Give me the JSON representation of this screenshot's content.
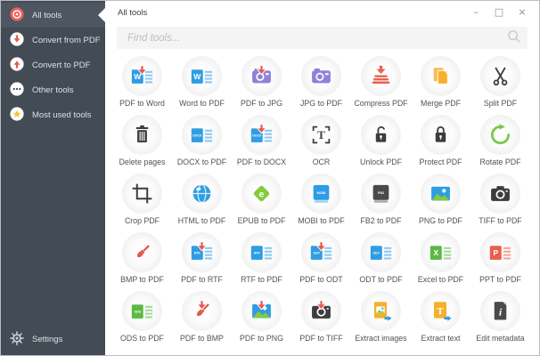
{
  "palette": {
    "sidebar_bg": "#434b55",
    "sidebar_selected_bg": "#4d5661",
    "accent_red": "#e8574d",
    "accent_blue": "#2f9de4",
    "accent_yellow": "#f5b02e",
    "accent_purple": "#8d82d8",
    "accent_green": "#5cb943",
    "accent_lime": "#84cc3a",
    "icon_dark": "#3d3d3d"
  },
  "window": {
    "controls": [
      {
        "name": "minimize",
        "glyph": "–"
      },
      {
        "name": "maximize",
        "glyph": "□"
      },
      {
        "name": "close",
        "glyph": "×"
      }
    ]
  },
  "sidebar": {
    "items": [
      {
        "label": "All tools",
        "icon": "target",
        "selected": true
      },
      {
        "label": "Convert from PDF",
        "icon": "arrow-down-circle",
        "selected": false
      },
      {
        "label": "Convert to PDF",
        "icon": "arrow-up-circle",
        "selected": false
      },
      {
        "label": "Other tools",
        "icon": "ellipsis-circle",
        "selected": false
      },
      {
        "label": "Most used tools",
        "icon": "star-circle",
        "selected": false
      }
    ],
    "settings": {
      "label": "Settings",
      "icon": "gear"
    }
  },
  "header": {
    "title": "All tools"
  },
  "search": {
    "placeholder": "Find tools..."
  },
  "tools": [
    {
      "label": "PDF to Word",
      "icon": {
        "type": "doc",
        "letters": "W",
        "color": "#2f9de4",
        "arrow": true
      }
    },
    {
      "label": "Word to PDF",
      "icon": {
        "type": "doc",
        "letters": "W",
        "color": "#2f9de4",
        "arrow": false
      }
    },
    {
      "label": "PDF to JPG",
      "icon": {
        "type": "photo",
        "color": "#8d82d8",
        "arrow": true
      }
    },
    {
      "label": "JPG to PDF",
      "icon": {
        "type": "photo",
        "color": "#8d82d8",
        "arrow": false
      }
    },
    {
      "label": "Compress PDF",
      "icon": {
        "type": "compress",
        "color": "#e8614c"
      }
    },
    {
      "label": "Merge PDF",
      "icon": {
        "type": "merge",
        "color": "#f5b02e"
      }
    },
    {
      "label": "Split PDF",
      "icon": {
        "type": "scissors",
        "color": "#3d3d3d"
      }
    },
    {
      "label": "Delete pages",
      "icon": {
        "type": "trash",
        "color": "#3d3d3d"
      }
    },
    {
      "label": "DOCX to PDF",
      "icon": {
        "type": "doc",
        "letters": "DOCX",
        "color": "#2f9de4",
        "arrow": false
      }
    },
    {
      "label": "PDF to DOCX",
      "icon": {
        "type": "doc",
        "letters": "DOCX",
        "color": "#2f9de4",
        "arrow": true
      }
    },
    {
      "label": "OCR",
      "icon": {
        "type": "ocr",
        "color": "#3d3d3d"
      }
    },
    {
      "label": "Unlock PDF",
      "icon": {
        "type": "unlock",
        "color": "#3d3d3d"
      }
    },
    {
      "label": "Protect PDF",
      "icon": {
        "type": "lock",
        "color": "#3d3d3d"
      }
    },
    {
      "label": "Rotate PDF",
      "icon": {
        "type": "rotate",
        "color": "#76c944"
      }
    },
    {
      "label": "Crop PDF",
      "icon": {
        "type": "crop",
        "color": "#3d3d3d"
      }
    },
    {
      "label": "HTML to PDF",
      "icon": {
        "type": "globe",
        "color": "#2f9de4"
      }
    },
    {
      "label": "EPUB to PDF",
      "icon": {
        "type": "epub",
        "color": "#84cc3a"
      }
    },
    {
      "label": "MOBI to PDF",
      "icon": {
        "type": "book",
        "letters": "MOBI",
        "color": "#2f9de4"
      }
    },
    {
      "label": "FB2 to PDF",
      "icon": {
        "type": "book",
        "letters": "FB2",
        "color": "#4a4a4a"
      }
    },
    {
      "label": "PNG to PDF",
      "icon": {
        "type": "image",
        "color": "#2f9de4",
        "arrow": false
      }
    },
    {
      "label": "TIFF to PDF",
      "icon": {
        "type": "camera",
        "color": "#3d3d3d",
        "arrow": false
      }
    },
    {
      "label": "BMP to PDF",
      "icon": {
        "type": "brush",
        "color": "#e8574d",
        "arrow": false
      }
    },
    {
      "label": "PDF to RTF",
      "icon": {
        "type": "doc",
        "letters": "RTF",
        "color": "#2f9de4",
        "arrow": true
      }
    },
    {
      "label": "RTF to PDF",
      "icon": {
        "type": "doc",
        "letters": "RTF",
        "color": "#2f9de4",
        "arrow": false
      }
    },
    {
      "label": "PDF to ODT",
      "icon": {
        "type": "doc",
        "letters": "ODT",
        "color": "#2f9de4",
        "arrow": true
      }
    },
    {
      "label": "ODT to PDF",
      "icon": {
        "type": "doc",
        "letters": "ODT",
        "color": "#2f9de4",
        "arrow": false
      }
    },
    {
      "label": "Excel to PDF",
      "icon": {
        "type": "doc",
        "letters": "X",
        "color": "#5cb943",
        "arrow": false
      }
    },
    {
      "label": "PPT to PDF",
      "icon": {
        "type": "doc",
        "letters": "P",
        "color": "#e8604c",
        "arrow": false
      }
    },
    {
      "label": "ODS to PDF",
      "icon": {
        "type": "doc",
        "letters": "ODS",
        "color": "#5cb943",
        "arrow": false
      }
    },
    {
      "label": "PDF to BMP",
      "icon": {
        "type": "brush",
        "color": "#e8574d",
        "arrow": true
      }
    },
    {
      "label": "PDF to PNG",
      "icon": {
        "type": "image",
        "color": "#2f9de4",
        "arrow": true
      }
    },
    {
      "label": "PDF to TIFF",
      "icon": {
        "type": "camera",
        "color": "#3d3d3d",
        "arrow": true
      }
    },
    {
      "label": "Extract images",
      "icon": {
        "type": "extract",
        "variant": "image",
        "color": "#f5b02e"
      }
    },
    {
      "label": "Extract text",
      "icon": {
        "type": "extract",
        "variant": "text",
        "color": "#f5b02e"
      }
    },
    {
      "label": "Edit metadata",
      "icon": {
        "type": "metadata",
        "color": "#4a4a4a"
      }
    }
  ]
}
